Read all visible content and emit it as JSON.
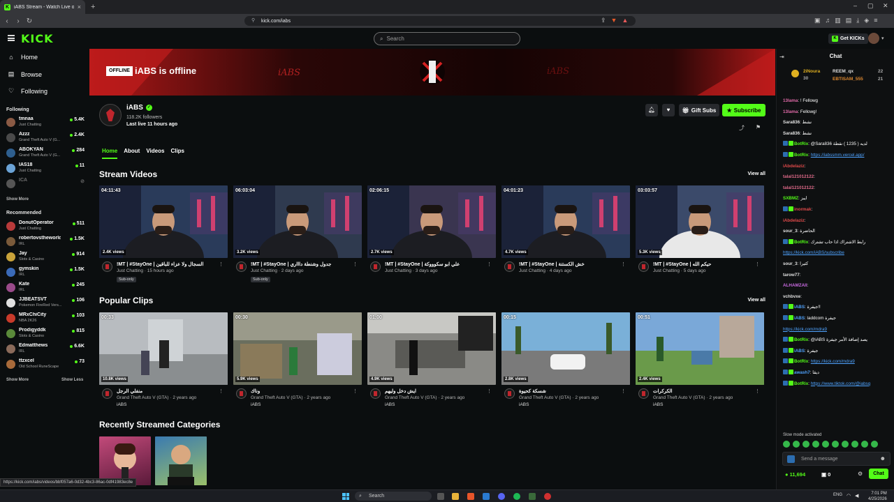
{
  "browser": {
    "tab_title": "iABS Stream - Watch Live on Kick",
    "url": "kick.com/iabs",
    "status_url": "https://kick.com/iabs/videos/bbf057a6-0d32-4bc3-86ac-0df41983ec8e"
  },
  "header": {
    "logo": "KICK",
    "search_placeholder": "Search",
    "get_kicks": "Get KICKs"
  },
  "sidebar": {
    "nav": [
      {
        "label": "Home",
        "icon": "home-icon"
      },
      {
        "label": "Browse",
        "icon": "browse-icon"
      },
      {
        "label": "Following",
        "icon": "heart-icon"
      }
    ],
    "following_heading": "Following",
    "following": [
      {
        "name": "tmnaa",
        "category": "Just Chatting",
        "viewers": "5.4K",
        "color": "#8a5a44"
      },
      {
        "name": "Azzz",
        "category": "Grand Theft Auto V (G...",
        "viewers": "2.4K",
        "color": "#4a4a4a"
      },
      {
        "name": "ABOKYAN",
        "category": "Grand Theft Auto V (G...",
        "viewers": "284",
        "color": "#2e5f8f"
      },
      {
        "name": "IAS18",
        "category": "Just Chatting",
        "viewers": "11",
        "color": "#6ba3d6"
      },
      {
        "name": "ICA",
        "category": "",
        "viewers": "",
        "color": "#555555",
        "offline": true
      }
    ],
    "show_more_1": "Show More",
    "recommended_heading": "Recommended",
    "recommended": [
      {
        "name": "DonutOperator",
        "category": "Just Chatting",
        "viewers": "511",
        "color": "#b83a3a"
      },
      {
        "name": "robertovstheworld",
        "category": "IRL",
        "viewers": "1.5K",
        "color": "#7a5a3a"
      },
      {
        "name": "Jay",
        "category": "Slots & Casino",
        "viewers": "914",
        "color": "#c9a33a"
      },
      {
        "name": "gymskin",
        "category": "IRL",
        "viewers": "1.5K",
        "color": "#3a6ab8"
      },
      {
        "name": "Kate",
        "category": "IRL",
        "viewers": "245",
        "color": "#9a4a8a"
      },
      {
        "name": "JJBEATSVT",
        "category": "Pokemon FireRed Vers...",
        "viewers": "106",
        "color": "#e0e0e0"
      },
      {
        "name": "MRxChiCity",
        "category": "NBA 2K26",
        "viewers": "103",
        "color": "#c83a2a"
      },
      {
        "name": "Prodigyddk",
        "category": "Slots & Casino",
        "viewers": "815",
        "color": "#5a8a3a"
      },
      {
        "name": "Edmatthews",
        "category": "IRL",
        "viewers": "6.6K",
        "color": "#8a6a5a"
      },
      {
        "name": "ttzxcel",
        "category": "Old School RuneScape",
        "viewers": "73",
        "color": "#a86a3a"
      }
    ],
    "show_more_2": "Show More",
    "show_less": "Show Less"
  },
  "banner": {
    "offline_badge": "OFFLINE",
    "offline_text": "iABS is offline"
  },
  "channel": {
    "name": "iABS",
    "followers": "118.2K followers",
    "last_live": "Last live 11 hours ago",
    "gift_subs": "Gift Subs",
    "subscribe": "Subscribe",
    "tabs": [
      "Home",
      "About",
      "Videos",
      "Clips"
    ]
  },
  "stream_videos": {
    "heading": "Stream Videos",
    "view_all": "View all",
    "items": [
      {
        "duration": "04:11:43",
        "views": "2.4K views",
        "title": "!MT | #StayOne | السجال ولا عزاء للباقين",
        "category": "Just Chatting",
        "time": "15 hours ago",
        "badge": "Sub-only"
      },
      {
        "duration": "06:03:04",
        "views": "3.2K views",
        "title": "!MT | #StayOne | جدول وشنطة داااري",
        "category": "Just Chatting",
        "time": "2 days ago",
        "badge": "Sub-only"
      },
      {
        "duration": "02:06:15",
        "views": "2.7K views",
        "title": "!MT | #StayOne | علي ابو سكوووكة",
        "category": "Just Chatting",
        "time": "3 days ago",
        "badge": ""
      },
      {
        "duration": "04:01:23",
        "views": "4.7K views",
        "title": "!MT | #StayOne | خش الكستنة",
        "category": "Just Chatting",
        "time": "4 days ago",
        "badge": ""
      },
      {
        "duration": "03:03:57",
        "views": "5.3K views",
        "title": "!MT | #StayOne | حيكم الله",
        "category": "Just Chatting",
        "time": "5 days ago",
        "badge": ""
      }
    ]
  },
  "popular_clips": {
    "heading": "Popular Clips",
    "view_all": "View all",
    "items": [
      {
        "duration": "00:33",
        "views": "10.8K views",
        "title": "منفلي الرجل",
        "category": "Grand Theft Auto V (GTA)",
        "time": "2 years ago",
        "channel": "iABS"
      },
      {
        "duration": "00:30",
        "views": "5.9K views",
        "title": "وناك",
        "category": "Grand Theft Auto V (GTA)",
        "time": "2 years ago",
        "channel": "iABS"
      },
      {
        "duration": "01:00",
        "views": "4.9K views",
        "title": "ايش دخل وليهم",
        "category": "Grand Theft Auto V (GTA)",
        "time": "2 years ago",
        "channel": "iABS"
      },
      {
        "duration": "00:15",
        "views": "2.8K views",
        "title": "شسكة كحيوة",
        "category": "Grand Theft Auto V (GTA)",
        "time": "2 years ago",
        "channel": "iABS"
      },
      {
        "duration": "00:51",
        "views": "2.4K views",
        "title": "الكركرات",
        "category": "Grand Theft Auto V (GTA)",
        "time": "2 years ago",
        "channel": "iABS"
      }
    ]
  },
  "categories": {
    "heading": "Recently Streamed Categories"
  },
  "chat": {
    "title": "Chat",
    "pinned": [
      {
        "name": "2iNoura",
        "count": "30"
      },
      {
        "name": "REEM_qx",
        "count": "22"
      },
      {
        "name": "EBTISAM_555",
        "count": "21"
      }
    ],
    "messages": [
      {
        "user": "13lama",
        "color": "#e06aa8",
        "text": "! Fellowg"
      },
      {
        "user": "13lama",
        "color": "#e06aa8",
        "text": "Fellowg!"
      },
      {
        "user": "Sara836",
        "color": "#e0e0e0",
        "text": "نشط"
      },
      {
        "user": "Sara836",
        "color": "#e0e0e0",
        "text": "نشط"
      },
      {
        "user": "BotRix",
        "color": "#53fc18",
        "text": "@Sara836 لديه ( 1235 ) نقطة",
        "bot": true
      },
      {
        "user": "BotRix",
        "color": "#53fc18",
        "text": "https://iabssmm.vercel.app/",
        "bot": true,
        "link": true
      },
      {
        "user": "iAbdelaziz",
        "color": "#e04a4a",
        "text": ""
      },
      {
        "user": "talal121012122",
        "color": "#e06a8a",
        "text": ""
      },
      {
        "user": "talal121012122",
        "color": "#e06a8a",
        "text": ""
      },
      {
        "user": "SXBMZ",
        "color": "#53fc18",
        "text": "ايبز"
      },
      {
        "user": "inormak",
        "color": "#e04a4a",
        "text": "",
        "bot": true
      },
      {
        "user": "iAbdelaziz",
        "color": "#e04a4a",
        "text": ""
      },
      {
        "user": "sour_3",
        "color": "#e0e0e0",
        "text": "الحاضرة"
      },
      {
        "user": "BotRix",
        "color": "#53fc18",
        "text": "رابط الاشتراك اذا حاب تشترك",
        "bot": true
      },
      {
        "user": "",
        "color": "#4fa3ff",
        "text": "https://kick.com/iABS/subscribe",
        "link": true
      },
      {
        "user": "sour_3",
        "color": "#e0e0e0",
        "text": "كثيرا"
      },
      {
        "user": "tarow77",
        "color": "#e0e0e0",
        "text": ""
      },
      {
        "user": "ALHAMZAII",
        "color": "#c86ae0",
        "text": ""
      },
      {
        "user": "vchbvxe",
        "color": "#e0e0e0",
        "text": ""
      },
      {
        "user": "iABS",
        "color": "#4fa3ff",
        "text": "جيفرة!!",
        "bot": true
      },
      {
        "user": "iABS",
        "color": "#4fa3ff",
        "text": "laddcom جيفرة",
        "bot": true
      },
      {
        "user": "",
        "color": "#4fa3ff",
        "text": "https://kick.com/mdra9",
        "link": true
      },
      {
        "user": "BotRix",
        "color": "#53fc18",
        "text": "@iABS يصد إضافة الأمر جيفرة",
        "bot": true
      },
      {
        "user": "iABS",
        "color": "#4fa3ff",
        "text": "جيفرة",
        "bot": true
      },
      {
        "user": "BotRix",
        "color": "#53fc18",
        "text": "https://kick.com/mdra9",
        "bot": true,
        "link": true
      },
      {
        "user": "awash7",
        "color": "#4fa3ff",
        "text": "ديقا",
        "bot": true
      },
      {
        "user": "BotRix",
        "color": "#53fc18",
        "text": "https://www.tiktok.com/@iabsq",
        "bot": true,
        "link": true
      }
    ],
    "slow_mode": "Slow mode activated",
    "input_placeholder": "Send a message",
    "kicks": "11,694",
    "zero": "0",
    "send": "Chat"
  },
  "taskbar": {
    "search": "Search",
    "lang": "ENG",
    "time": "7:01 PM",
    "date": "4/25/2026"
  },
  "colors": {
    "accent": "#53fc18",
    "bg": "#0b0e0f"
  }
}
